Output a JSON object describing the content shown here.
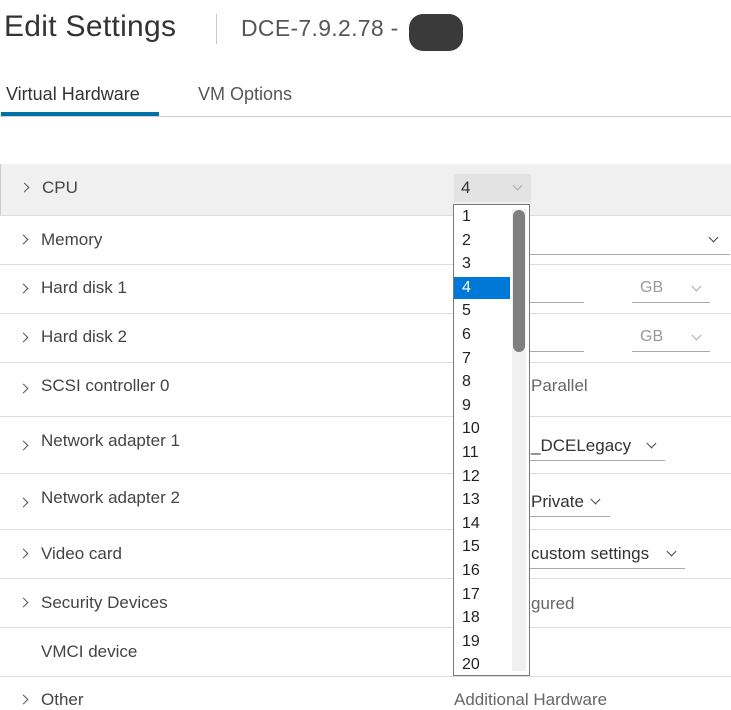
{
  "header": {
    "title": "Edit Settings",
    "vm_name": "DCE-7.9.2.78 -"
  },
  "tabs": [
    {
      "label": "Virtual Hardware",
      "active": true
    },
    {
      "label": "VM Options",
      "active": false
    }
  ],
  "rows": {
    "cpu": {
      "label": "CPU",
      "value": "4"
    },
    "memory": {
      "label": "Memory"
    },
    "hard_disk_1": {
      "label": "Hard disk 1",
      "unit": "GB"
    },
    "hard_disk_2": {
      "label": "Hard disk 2",
      "unit": "GB"
    },
    "scsi": {
      "label": "SCSI controller 0",
      "value": "Parallel"
    },
    "net1": {
      "label": "Network adapter 1",
      "value": "_DCELegacy"
    },
    "net2": {
      "label": "Network adapter 2",
      "value": "Private"
    },
    "video": {
      "label": "Video card",
      "value": "custom settings"
    },
    "security": {
      "label": "Security Devices",
      "value": "gured"
    },
    "vmci": {
      "label": "VMCI device"
    },
    "other": {
      "label": "Other",
      "value": "Additional Hardware"
    }
  },
  "cpu_dropdown": {
    "options": [
      "1",
      "2",
      "3",
      "4",
      "5",
      "6",
      "7",
      "8",
      "9",
      "10",
      "11",
      "12",
      "13",
      "14",
      "15",
      "16",
      "17",
      "18",
      "19",
      "20"
    ],
    "selected": "4"
  },
  "colors": {
    "accent": "#0072a3",
    "selection": "#0078d7"
  }
}
